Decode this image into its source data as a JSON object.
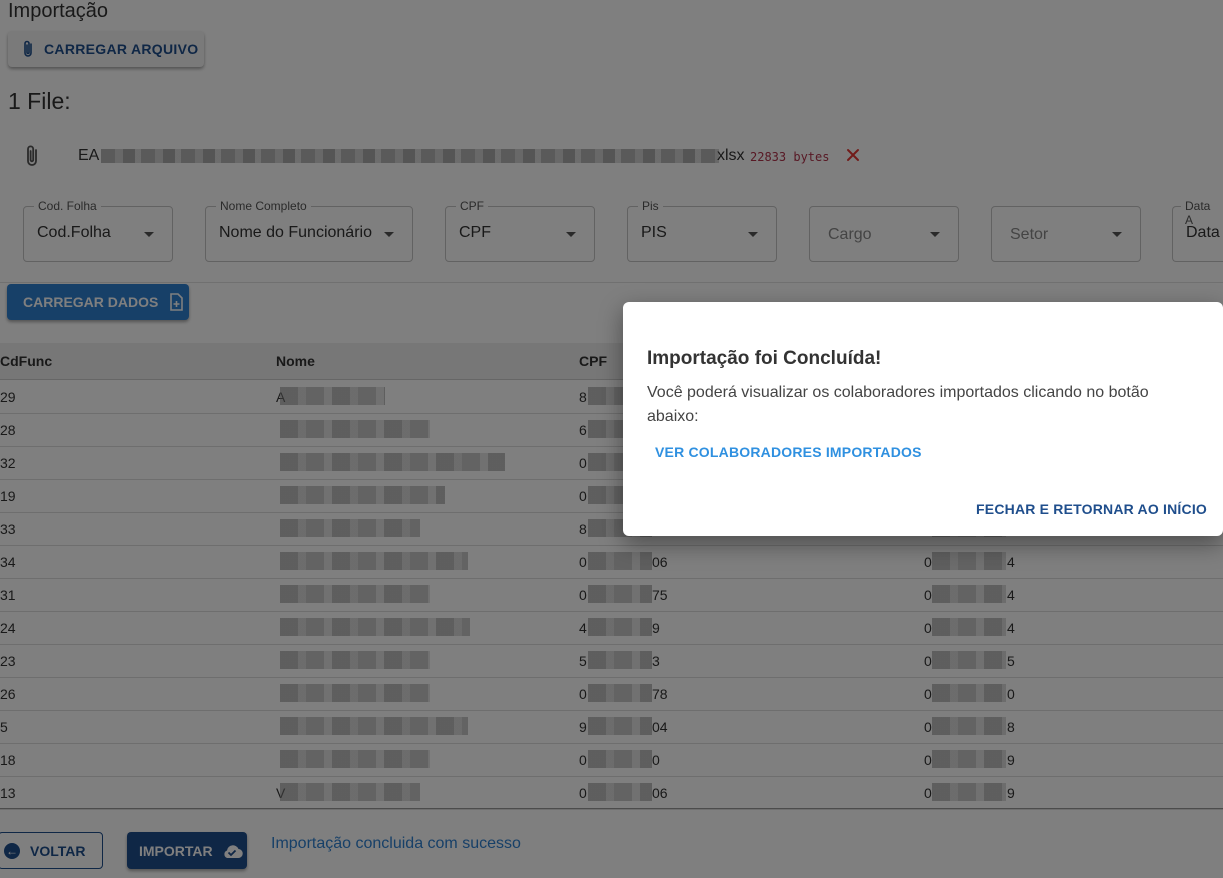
{
  "page": {
    "title": "Importação",
    "upload_button": "CARREGAR ARQUIVO",
    "files_title": "1 File:",
    "file": {
      "name_start": "EA",
      "extension": "xlsx",
      "size": "22833 bytes"
    }
  },
  "mapping_fields": [
    {
      "legend": "Cod. Folha",
      "value": "Cod.Folha"
    },
    {
      "legend": "Nome Completo",
      "value": "Nome do Funcionário"
    },
    {
      "legend": "CPF",
      "value": "CPF"
    },
    {
      "legend": "Pis",
      "value": "PIS"
    },
    {
      "legend": "",
      "value": "Cargo"
    },
    {
      "legend": "",
      "value": "Setor"
    },
    {
      "legend": "Data A",
      "value": "Data"
    }
  ],
  "load_data_button": "CARREGAR DADOS",
  "table": {
    "headers": [
      "CdFunc",
      "Nome",
      "CPF"
    ],
    "rows": [
      {
        "cdfunc": "29",
        "nome": "A",
        "cpf": "8",
        "cpf_end": "",
        "pis": "",
        "pis_end": ""
      },
      {
        "cdfunc": "28",
        "nome": "",
        "cpf": "6",
        "cpf_end": "",
        "pis": "",
        "pis_end": ""
      },
      {
        "cdfunc": "32",
        "nome": "",
        "cpf": "0",
        "cpf_end": "",
        "pis": "",
        "pis_end": ""
      },
      {
        "cdfunc": "19",
        "nome": "",
        "cpf": "0",
        "cpf_end": "",
        "pis": "",
        "pis_end": ""
      },
      {
        "cdfunc": "33",
        "nome": "",
        "cpf": "8",
        "cpf_end": "",
        "pis": "",
        "pis_end": ""
      },
      {
        "cdfunc": "34",
        "nome": "",
        "cpf": "0",
        "cpf_end": "06",
        "pis": "0",
        "pis_end": "4"
      },
      {
        "cdfunc": "31",
        "nome": "",
        "cpf": "0",
        "cpf_end": "75",
        "pis": "0",
        "pis_end": "4"
      },
      {
        "cdfunc": "24",
        "nome": "",
        "cpf": "4",
        "cpf_end": "9",
        "pis": "0",
        "pis_end": "4"
      },
      {
        "cdfunc": "23",
        "nome": "",
        "cpf": "5",
        "cpf_end": "3",
        "pis": "0",
        "pis_end": "5"
      },
      {
        "cdfunc": "26",
        "nome": "",
        "cpf": "0",
        "cpf_end": "78",
        "pis": "0",
        "pis_end": "0"
      },
      {
        "cdfunc": "5",
        "nome": "",
        "cpf": "9",
        "cpf_end": "04",
        "pis": "0",
        "pis_end": "8"
      },
      {
        "cdfunc": "18",
        "nome": "",
        "cpf": "0",
        "cpf_end": "0",
        "pis": "0",
        "pis_end": "9"
      },
      {
        "cdfunc": "13",
        "nome": "V",
        "cpf": "0",
        "cpf_end": "06",
        "pis": "0",
        "pis_end": "9"
      }
    ]
  },
  "footer": {
    "back_button": "VOLTAR",
    "import_button": "IMPORTAR",
    "status": "Importação concluida com sucesso"
  },
  "dialog": {
    "title": "Importação foi Concluída!",
    "body": "Você poderá visualizar os colaboradores importados clicando no botão abaixo:",
    "view_link": "VER COLABORADORES IMPORTADOS",
    "close_button": "FECHAR E RETORNAR AO INÍCIO"
  },
  "colors": {
    "primary": "#1f4e8c",
    "accent": "#2f80d1",
    "remove": "#e53935",
    "file_size": "#b0324a"
  }
}
